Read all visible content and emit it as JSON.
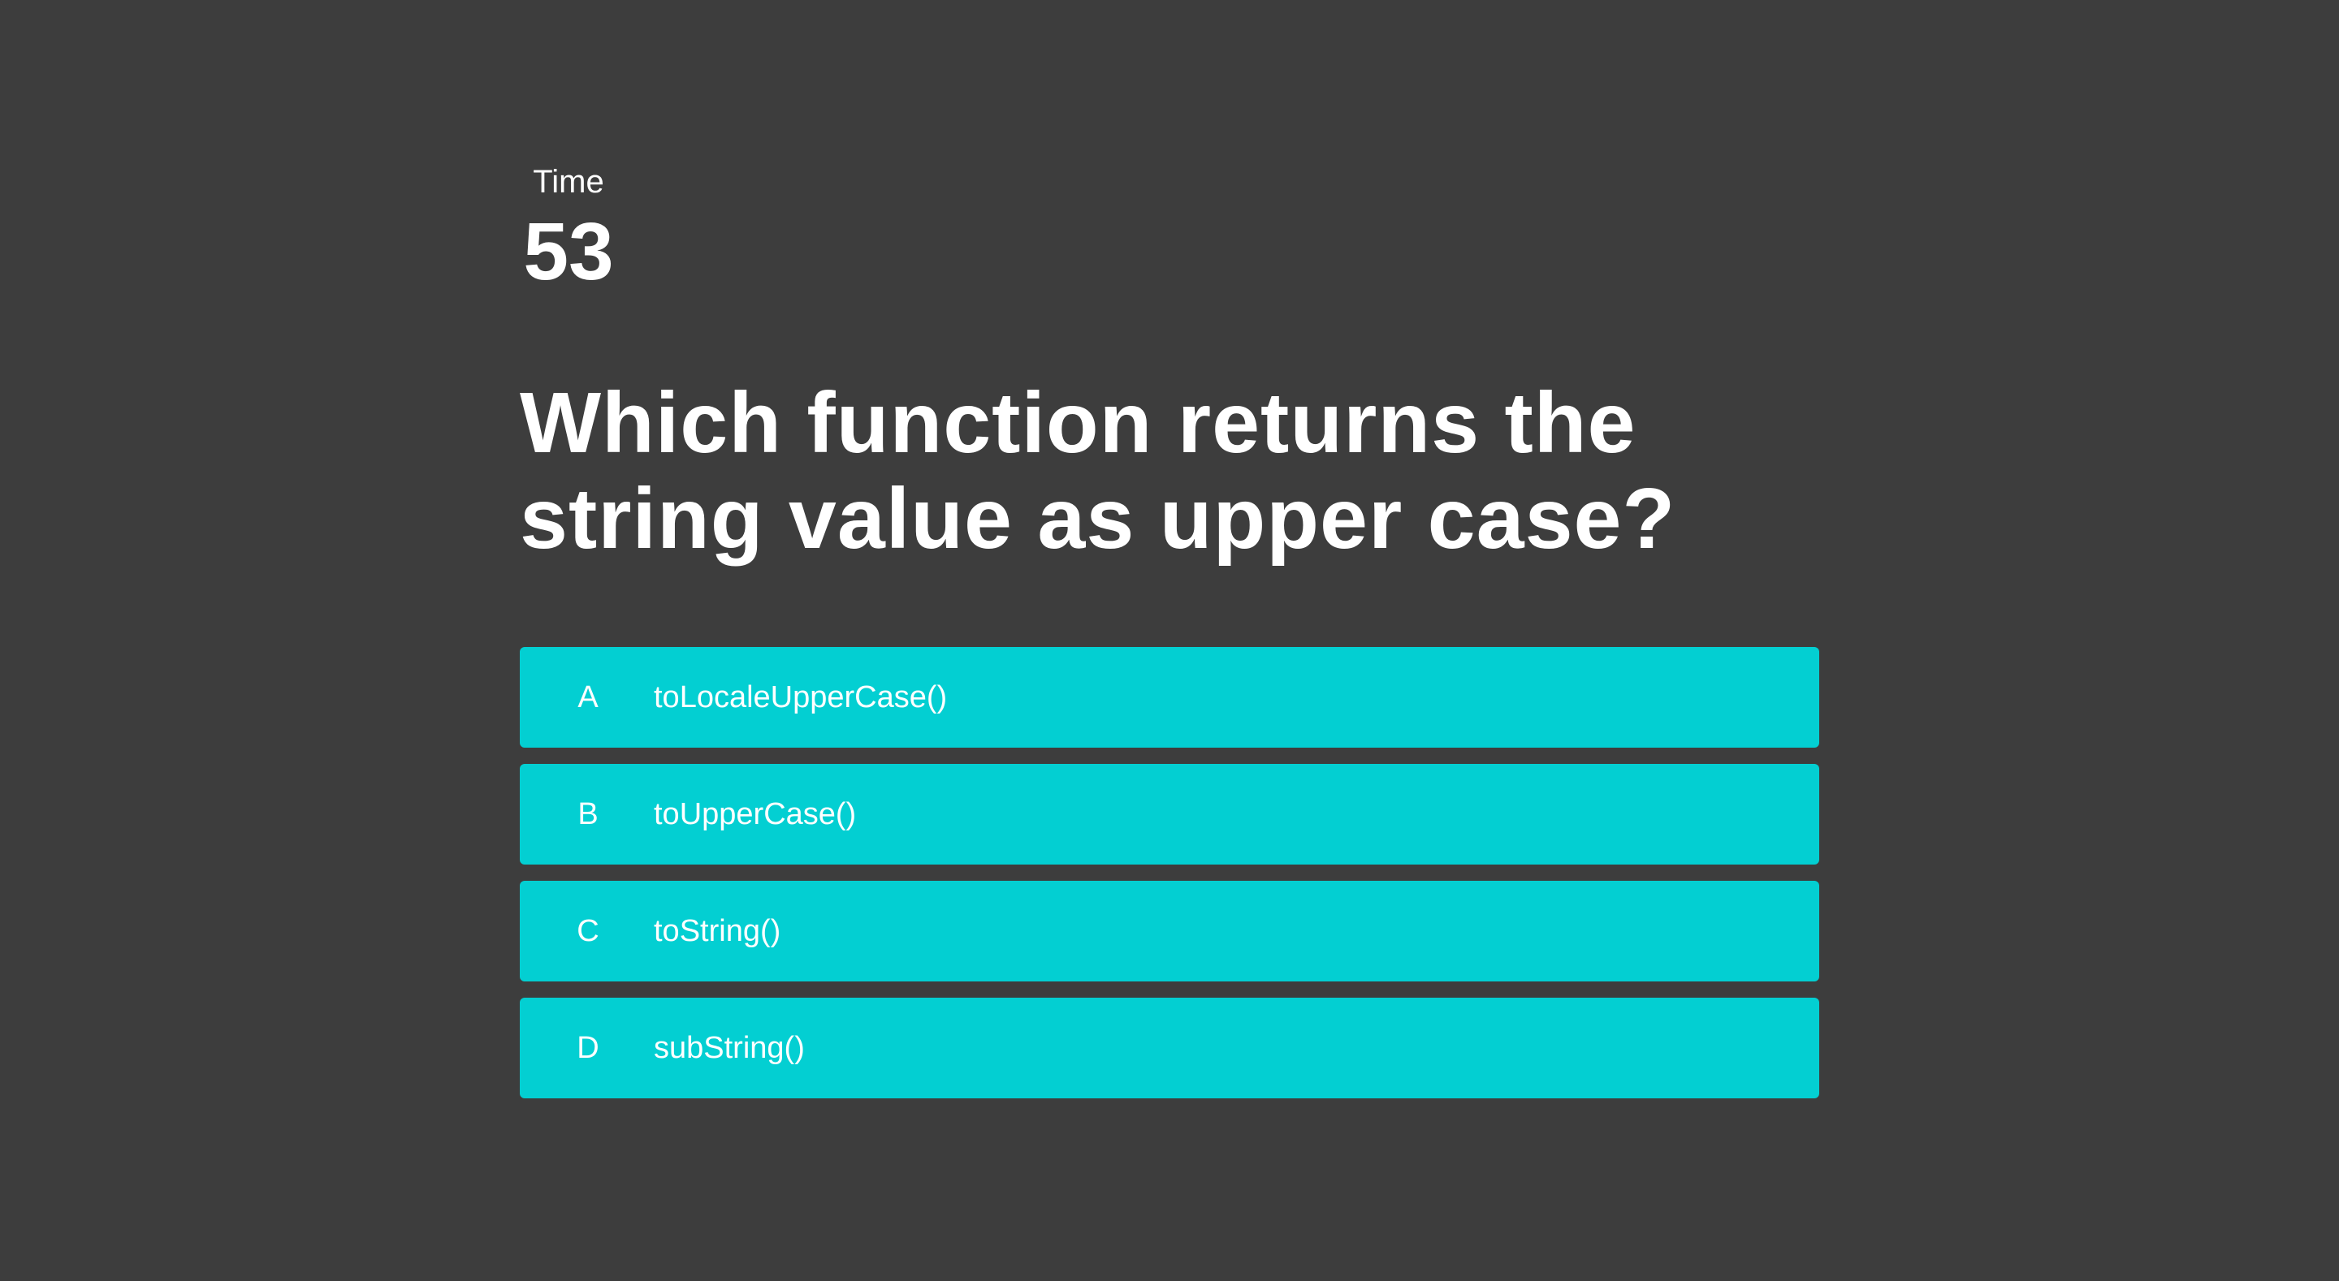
{
  "timer": {
    "label": "Time",
    "value": "53"
  },
  "question": {
    "text": "Which function returns the string value as upper case?"
  },
  "answers": [
    {
      "letter": "A",
      "text": "toLocaleUpperCase()"
    },
    {
      "letter": "B",
      "text": "toUpperCase()"
    },
    {
      "letter": "C",
      "text": "toString()"
    },
    {
      "letter": "D",
      "text": "subString()"
    }
  ],
  "colors": {
    "background": "#3d3d3d",
    "answer_background": "#03cfd2",
    "text": "#ffffff"
  }
}
